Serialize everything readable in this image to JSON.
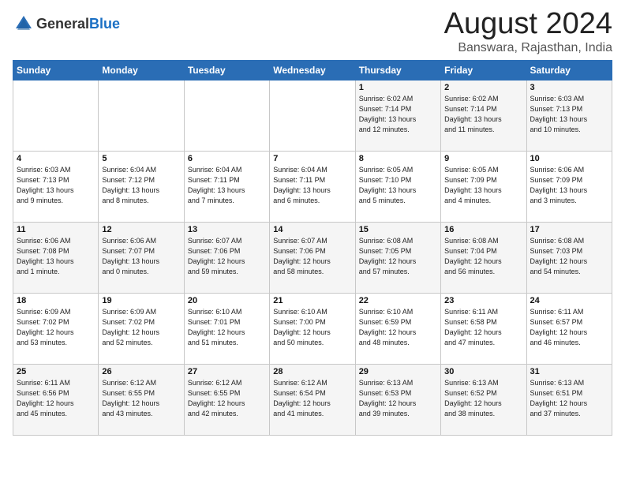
{
  "header": {
    "logo_general": "General",
    "logo_blue": "Blue",
    "month_year": "August 2024",
    "location": "Banswara, Rajasthan, India"
  },
  "days_of_week": [
    "Sunday",
    "Monday",
    "Tuesday",
    "Wednesday",
    "Thursday",
    "Friday",
    "Saturday"
  ],
  "weeks": [
    [
      {
        "day": "",
        "info": ""
      },
      {
        "day": "",
        "info": ""
      },
      {
        "day": "",
        "info": ""
      },
      {
        "day": "",
        "info": ""
      },
      {
        "day": "1",
        "info": "Sunrise: 6:02 AM\nSunset: 7:14 PM\nDaylight: 13 hours\nand 12 minutes."
      },
      {
        "day": "2",
        "info": "Sunrise: 6:02 AM\nSunset: 7:14 PM\nDaylight: 13 hours\nand 11 minutes."
      },
      {
        "day": "3",
        "info": "Sunrise: 6:03 AM\nSunset: 7:13 PM\nDaylight: 13 hours\nand 10 minutes."
      }
    ],
    [
      {
        "day": "4",
        "info": "Sunrise: 6:03 AM\nSunset: 7:13 PM\nDaylight: 13 hours\nand 9 minutes."
      },
      {
        "day": "5",
        "info": "Sunrise: 6:04 AM\nSunset: 7:12 PM\nDaylight: 13 hours\nand 8 minutes."
      },
      {
        "day": "6",
        "info": "Sunrise: 6:04 AM\nSunset: 7:11 PM\nDaylight: 13 hours\nand 7 minutes."
      },
      {
        "day": "7",
        "info": "Sunrise: 6:04 AM\nSunset: 7:11 PM\nDaylight: 13 hours\nand 6 minutes."
      },
      {
        "day": "8",
        "info": "Sunrise: 6:05 AM\nSunset: 7:10 PM\nDaylight: 13 hours\nand 5 minutes."
      },
      {
        "day": "9",
        "info": "Sunrise: 6:05 AM\nSunset: 7:09 PM\nDaylight: 13 hours\nand 4 minutes."
      },
      {
        "day": "10",
        "info": "Sunrise: 6:06 AM\nSunset: 7:09 PM\nDaylight: 13 hours\nand 3 minutes."
      }
    ],
    [
      {
        "day": "11",
        "info": "Sunrise: 6:06 AM\nSunset: 7:08 PM\nDaylight: 13 hours\nand 1 minute."
      },
      {
        "day": "12",
        "info": "Sunrise: 6:06 AM\nSunset: 7:07 PM\nDaylight: 13 hours\nand 0 minutes."
      },
      {
        "day": "13",
        "info": "Sunrise: 6:07 AM\nSunset: 7:06 PM\nDaylight: 12 hours\nand 59 minutes."
      },
      {
        "day": "14",
        "info": "Sunrise: 6:07 AM\nSunset: 7:06 PM\nDaylight: 12 hours\nand 58 minutes."
      },
      {
        "day": "15",
        "info": "Sunrise: 6:08 AM\nSunset: 7:05 PM\nDaylight: 12 hours\nand 57 minutes."
      },
      {
        "day": "16",
        "info": "Sunrise: 6:08 AM\nSunset: 7:04 PM\nDaylight: 12 hours\nand 56 minutes."
      },
      {
        "day": "17",
        "info": "Sunrise: 6:08 AM\nSunset: 7:03 PM\nDaylight: 12 hours\nand 54 minutes."
      }
    ],
    [
      {
        "day": "18",
        "info": "Sunrise: 6:09 AM\nSunset: 7:02 PM\nDaylight: 12 hours\nand 53 minutes."
      },
      {
        "day": "19",
        "info": "Sunrise: 6:09 AM\nSunset: 7:02 PM\nDaylight: 12 hours\nand 52 minutes."
      },
      {
        "day": "20",
        "info": "Sunrise: 6:10 AM\nSunset: 7:01 PM\nDaylight: 12 hours\nand 51 minutes."
      },
      {
        "day": "21",
        "info": "Sunrise: 6:10 AM\nSunset: 7:00 PM\nDaylight: 12 hours\nand 50 minutes."
      },
      {
        "day": "22",
        "info": "Sunrise: 6:10 AM\nSunset: 6:59 PM\nDaylight: 12 hours\nand 48 minutes."
      },
      {
        "day": "23",
        "info": "Sunrise: 6:11 AM\nSunset: 6:58 PM\nDaylight: 12 hours\nand 47 minutes."
      },
      {
        "day": "24",
        "info": "Sunrise: 6:11 AM\nSunset: 6:57 PM\nDaylight: 12 hours\nand 46 minutes."
      }
    ],
    [
      {
        "day": "25",
        "info": "Sunrise: 6:11 AM\nSunset: 6:56 PM\nDaylight: 12 hours\nand 45 minutes."
      },
      {
        "day": "26",
        "info": "Sunrise: 6:12 AM\nSunset: 6:55 PM\nDaylight: 12 hours\nand 43 minutes."
      },
      {
        "day": "27",
        "info": "Sunrise: 6:12 AM\nSunset: 6:55 PM\nDaylight: 12 hours\nand 42 minutes."
      },
      {
        "day": "28",
        "info": "Sunrise: 6:12 AM\nSunset: 6:54 PM\nDaylight: 12 hours\nand 41 minutes."
      },
      {
        "day": "29",
        "info": "Sunrise: 6:13 AM\nSunset: 6:53 PM\nDaylight: 12 hours\nand 39 minutes."
      },
      {
        "day": "30",
        "info": "Sunrise: 6:13 AM\nSunset: 6:52 PM\nDaylight: 12 hours\nand 38 minutes."
      },
      {
        "day": "31",
        "info": "Sunrise: 6:13 AM\nSunset: 6:51 PM\nDaylight: 12 hours\nand 37 minutes."
      }
    ]
  ]
}
